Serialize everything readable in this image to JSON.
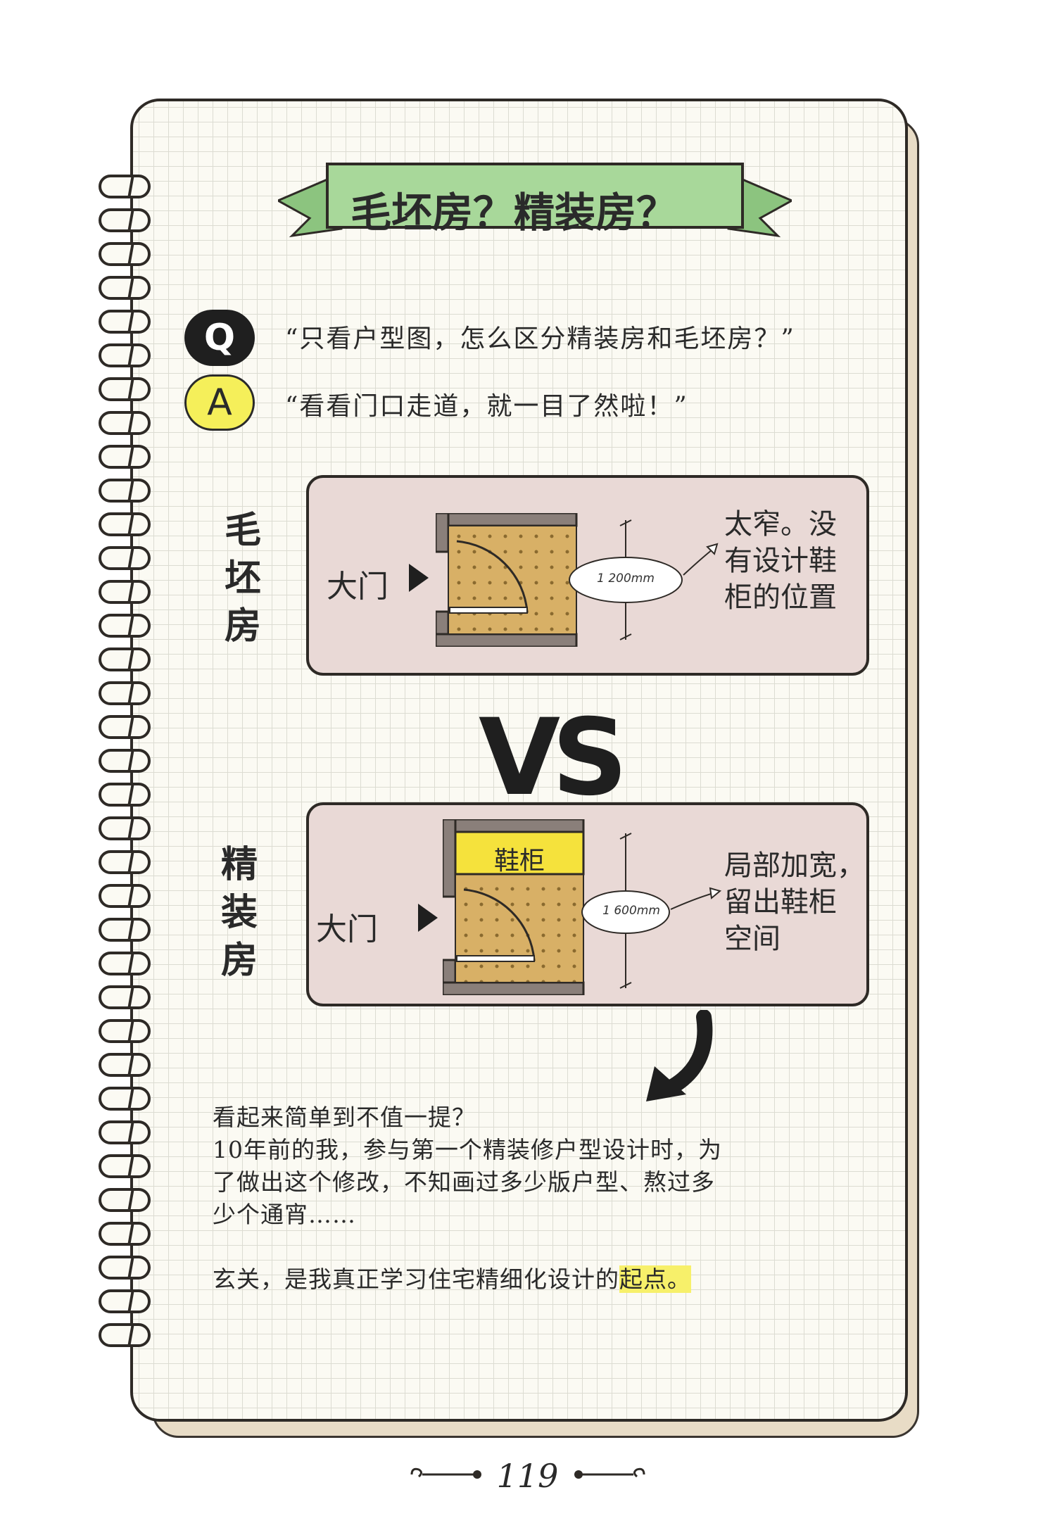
{
  "title": "毛坯房？精装房？",
  "qa": {
    "q_badge": "Q",
    "a_badge": "A",
    "question": "“只看户型图，怎么区分精装房和毛坯房？”",
    "answer": "“看看门口走道，就一目了然啦！”"
  },
  "rough_house": {
    "label": [
      "毛",
      "坯",
      "房"
    ],
    "door_label": "大门",
    "dimension": "1 200mm",
    "note": [
      "太窄。没",
      "有设计鞋",
      "柜的位置"
    ]
  },
  "vs": "VS",
  "finished_house": {
    "label": [
      "精",
      "装",
      "房"
    ],
    "door_label": "大门",
    "cabinet_label": "鞋柜",
    "dimension": "1 600mm",
    "note": [
      "局部加宽，",
      "留出鞋柜",
      "空间"
    ]
  },
  "body": {
    "lines": [
      "看起来简单到不值一提？",
      "10年前的我，参与第一个精装修户型设计时，为",
      "了做出这个修改，不知画过多少版户型、熬过多",
      "少个通宵……"
    ],
    "last_prefix": "玄关，是我真正学习住宅精细化设计的",
    "last_highlight": "起点。"
  },
  "page_number": "119",
  "colors": {
    "banner_green": "#a8d89a",
    "banner_dark_green": "#8cc47f",
    "panel_pink": "#e9d9d6",
    "floor_tan": "#d8b066",
    "cabinet_yellow": "#f5e23c",
    "wall_gray": "#8a7f7a",
    "a_badge_yellow": "#f5ef5a",
    "highlight_yellow": "#f7f06a"
  },
  "icons": [
    "spiral-ring-icon",
    "play-arrow-icon",
    "door-swing-icon",
    "curved-arrow-icon"
  ]
}
